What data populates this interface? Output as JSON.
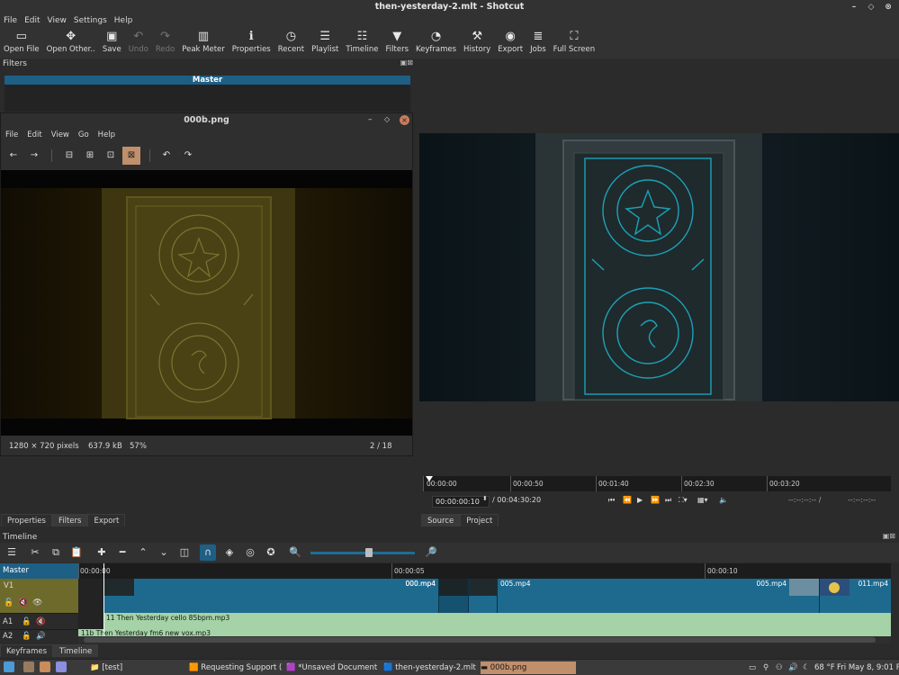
{
  "window": {
    "title": "then-yesterday-2.mlt - Shotcut"
  },
  "menu": [
    "File",
    "Edit",
    "View",
    "Settings",
    "Help"
  ],
  "toolbar": [
    {
      "label": "Open File",
      "icon": "open-file-icon",
      "glyph": "▭",
      "enabled": true
    },
    {
      "label": "Open Other..",
      "icon": "open-other-icon",
      "glyph": "✥",
      "enabled": true
    },
    {
      "label": "Save",
      "icon": "save-icon",
      "glyph": "▣",
      "enabled": true
    },
    {
      "label": "Undo",
      "icon": "undo-icon",
      "glyph": "↶",
      "enabled": false
    },
    {
      "label": "Redo",
      "icon": "redo-icon",
      "glyph": "↷",
      "enabled": false
    },
    {
      "label": "Peak Meter",
      "icon": "peak-meter-icon",
      "glyph": "▥",
      "enabled": true
    },
    {
      "label": "Properties",
      "icon": "properties-icon",
      "glyph": "ℹ",
      "enabled": true
    },
    {
      "label": "Recent",
      "icon": "recent-icon",
      "glyph": "◷",
      "enabled": true
    },
    {
      "label": "Playlist",
      "icon": "playlist-icon",
      "glyph": "☰",
      "enabled": true
    },
    {
      "label": "Timeline",
      "icon": "timeline-icon",
      "glyph": "☷",
      "enabled": true
    },
    {
      "label": "Filters",
      "icon": "filters-icon",
      "glyph": "▼",
      "enabled": true
    },
    {
      "label": "Keyframes",
      "icon": "keyframes-icon",
      "glyph": "◔",
      "enabled": true
    },
    {
      "label": "History",
      "icon": "history-icon",
      "glyph": "⚒",
      "enabled": true
    },
    {
      "label": "Export",
      "icon": "export-icon",
      "glyph": "◉",
      "enabled": true
    },
    {
      "label": "Jobs",
      "icon": "jobs-icon",
      "glyph": "≣",
      "enabled": true
    },
    {
      "label": "Full Screen",
      "icon": "full-screen-icon",
      "glyph": "⛶",
      "enabled": true
    }
  ],
  "filters": {
    "title": "Filters",
    "master": "Master"
  },
  "viewer": {
    "title": "000b.png",
    "menu": [
      "File",
      "Edit",
      "View",
      "Go",
      "Help"
    ],
    "status": {
      "dims": "1280 × 720 pixels",
      "size": "637.9 kB",
      "zoom": "57%",
      "index": "2 / 18"
    }
  },
  "player": {
    "ruler": [
      "00:00:00",
      "00:00:50",
      "00:01:40",
      "00:02:30",
      "00:03:20"
    ],
    "position": "00:00:00:10",
    "duration": "/ 00:04:30:20",
    "in_point": "--:--:--:-- /",
    "out_point": "--:--:--:--",
    "tabs": [
      "Source",
      "Project"
    ]
  },
  "left_tabs": [
    "Properties",
    "Filters",
    "Export"
  ],
  "timeline": {
    "title": "Timeline",
    "ruler": [
      "00:00:00",
      "00:00:05",
      "00:00:10"
    ],
    "tracks": [
      {
        "name": "Master"
      },
      {
        "name": "V1"
      },
      {
        "name": "A1"
      },
      {
        "name": "A2"
      }
    ],
    "video_clips": [
      "000.mp4",
      "000.mp4",
      "005.mp4",
      "005.mp4",
      "011.mp4"
    ],
    "audio_clips": [
      "11 Then Yesterday cello 85bpm.mp3",
      "11b Then Yesterday fm6 new vox.mp3"
    ]
  },
  "bottom_tabs": [
    "Keyframes",
    "Timeline"
  ],
  "taskbar": {
    "items": [
      "[test]",
      "Requesting Support (20...",
      "*Unsaved Document 1",
      "then-yesterday-2.mlt - ...",
      "000b.png"
    ],
    "weather": "68 °F",
    "clock": "Fri May 8,  9:01 PM"
  },
  "colors": {
    "accent": "#1e5f85",
    "clip": "#1e6a8f",
    "audio": "#a5d2a7",
    "track_header": "#6d6a2c"
  }
}
